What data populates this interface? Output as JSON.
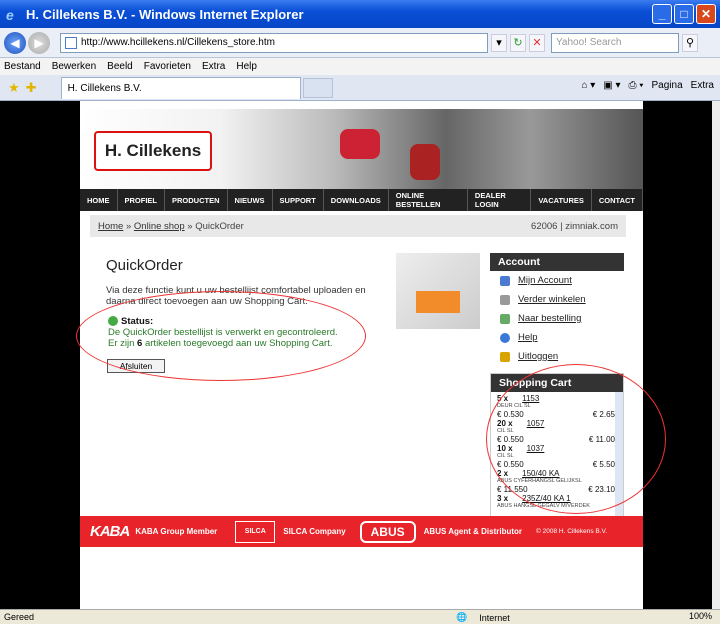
{
  "window": {
    "title": "H. Cillekens B.V. - Windows Internet Explorer"
  },
  "address": {
    "url": "http://www.hcillekens.nl/Cillekens_store.htm",
    "search_placeholder": "Yahoo! Search"
  },
  "menu": [
    "Bestand",
    "Bewerken",
    "Beeld",
    "Favorieten",
    "Extra",
    "Help"
  ],
  "tab": {
    "label": "H. Cillekens B.V."
  },
  "tools": {
    "page": "Pagina",
    "extra": "Extra"
  },
  "site": {
    "logo": "H. Cillekens",
    "nav": [
      "HOME",
      "PROFIEL",
      "PRODUCTEN",
      "NIEUWS",
      "SUPPORT",
      "DOWNLOADS",
      "ONLINE BESTELLEN",
      "DEALER LOGIN",
      "VACATURES",
      "CONTACT"
    ],
    "breadcrumb": {
      "home": "Home",
      "shop": "Online shop",
      "current": "QuickOrder",
      "sep": "»",
      "user": "62006 | zimniak.com"
    },
    "title": "QuickOrder",
    "intro": "Via deze functie kunt u uw bestellijst comfortabel uploaden en daarna direct toevoegen aan uw Shopping Cart.",
    "status_label": "Status:",
    "status_line1": "De QuickOrder bestellijst is verwerkt en gecontroleerd.",
    "status_line2_a": "Er zijn ",
    "status_count": "6",
    "status_line2_b": " artikelen toegevoegd aan uw Shopping Cart.",
    "close_button": "Afsluiten",
    "account": {
      "title": "Account",
      "links": [
        "Mijn Account",
        "Verder winkelen",
        "Naar bestelling",
        "Help",
        "Uitloggen"
      ]
    },
    "cart": {
      "title": "Shopping Cart",
      "items": [
        {
          "qty": "5 x",
          "code": "1153",
          "desc": "DEUR CIL SL",
          "price": "€ 0.530",
          "total": "€ 2.65"
        },
        {
          "qty": "20 x",
          "code": "1057",
          "desc": "CIL SL",
          "price": "€ 0.550",
          "total": "€ 11.00"
        },
        {
          "qty": "10 x",
          "code": "1037",
          "desc": "CIL SL",
          "price": "€ 0.550",
          "total": "€ 5.50"
        },
        {
          "qty": "2 x",
          "code": "150/40 KA",
          "desc": "ABUS CYFERHANGSL GELIJKSL",
          "price": "€ 11.550",
          "total": "€ 23.10"
        },
        {
          "qty": "3 x",
          "code": "235Z/40 KA 1",
          "desc": "ABUS HANGSL GEGALV M/VERDEK",
          "price": "",
          "total": ""
        }
      ]
    },
    "footer": {
      "kaba": "KABA",
      "kaba_text": "KABA Group Member",
      "silca": "SILCA",
      "silca_text": "SILCA Company",
      "abus": "ABUS",
      "abus_text": "ABUS Agent & Distributor",
      "copyright": "© 2008 H. Cillekens B.V."
    }
  },
  "statusbar": {
    "left": "Gereed",
    "zone": "Internet",
    "zoom": "100%"
  },
  "colors": {
    "accent": "#e8232a",
    "nav": "#222222",
    "status": "#2a7a2a"
  }
}
